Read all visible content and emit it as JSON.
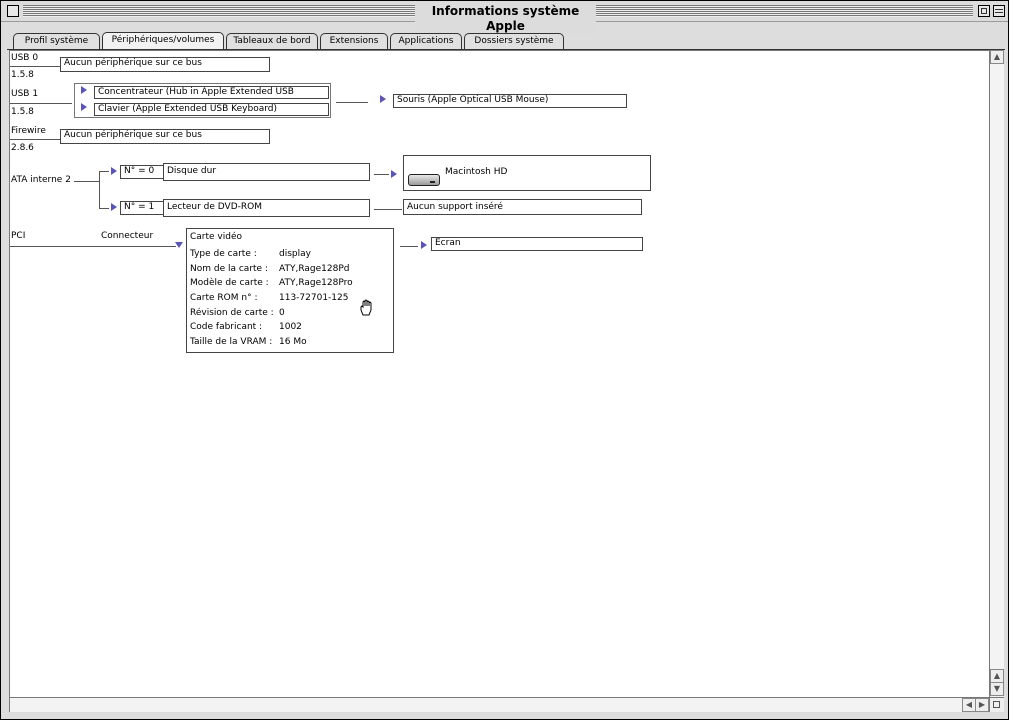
{
  "window": {
    "title": "Informations système Apple"
  },
  "tabs": [
    {
      "label": "Profil système"
    },
    {
      "label": "Périphériques/volumes"
    },
    {
      "label": "Tableaux de bord"
    },
    {
      "label": "Extensions"
    },
    {
      "label": "Applications"
    },
    {
      "label": "Dossiers système"
    }
  ],
  "usb0": {
    "bus": "USB 0",
    "version": "1.5.8",
    "status": "Aucun périphérique sur ce bus"
  },
  "usb1": {
    "bus": "USB 1",
    "version": "1.5.8",
    "hub": "Concentrateur (Hub in Apple Extended USB",
    "keyboard": "Clavier (Apple Extended USB Keyboard)",
    "mouse": "Souris (Apple Optical USB Mouse)"
  },
  "firewire": {
    "bus": "Firewire",
    "version": "2.8.6",
    "status": "Aucun périphérique sur ce bus"
  },
  "ata": {
    "bus": "ATA interne 2",
    "dev0_id": "N° = 0",
    "dev0_name": "Disque dur",
    "dev0_volume": "Macintosh HD",
    "dev1_id": "N° = 1",
    "dev1_name": "Lecteur de DVD-ROM",
    "dev1_status": "Aucun support inséré"
  },
  "pci": {
    "bus": "PCI",
    "slot": "Connecteur",
    "card_title": "Carte vidéo",
    "rows": [
      {
        "label": "Type de carte :",
        "value": "display"
      },
      {
        "label": "Nom de la carte :",
        "value": "ATY,Rage128Pd"
      },
      {
        "label": "Modèle de carte :",
        "value": "ATY,Rage128Pro"
      },
      {
        "label": "Carte ROM n° :",
        "value": "113-72701-125"
      },
      {
        "label": "Révision de carte :",
        "value": "0"
      },
      {
        "label": "Code fabricant :",
        "value": "1002"
      },
      {
        "label": "Taille de la VRAM :",
        "value": "16 Mo"
      }
    ],
    "display": "Écran"
  }
}
